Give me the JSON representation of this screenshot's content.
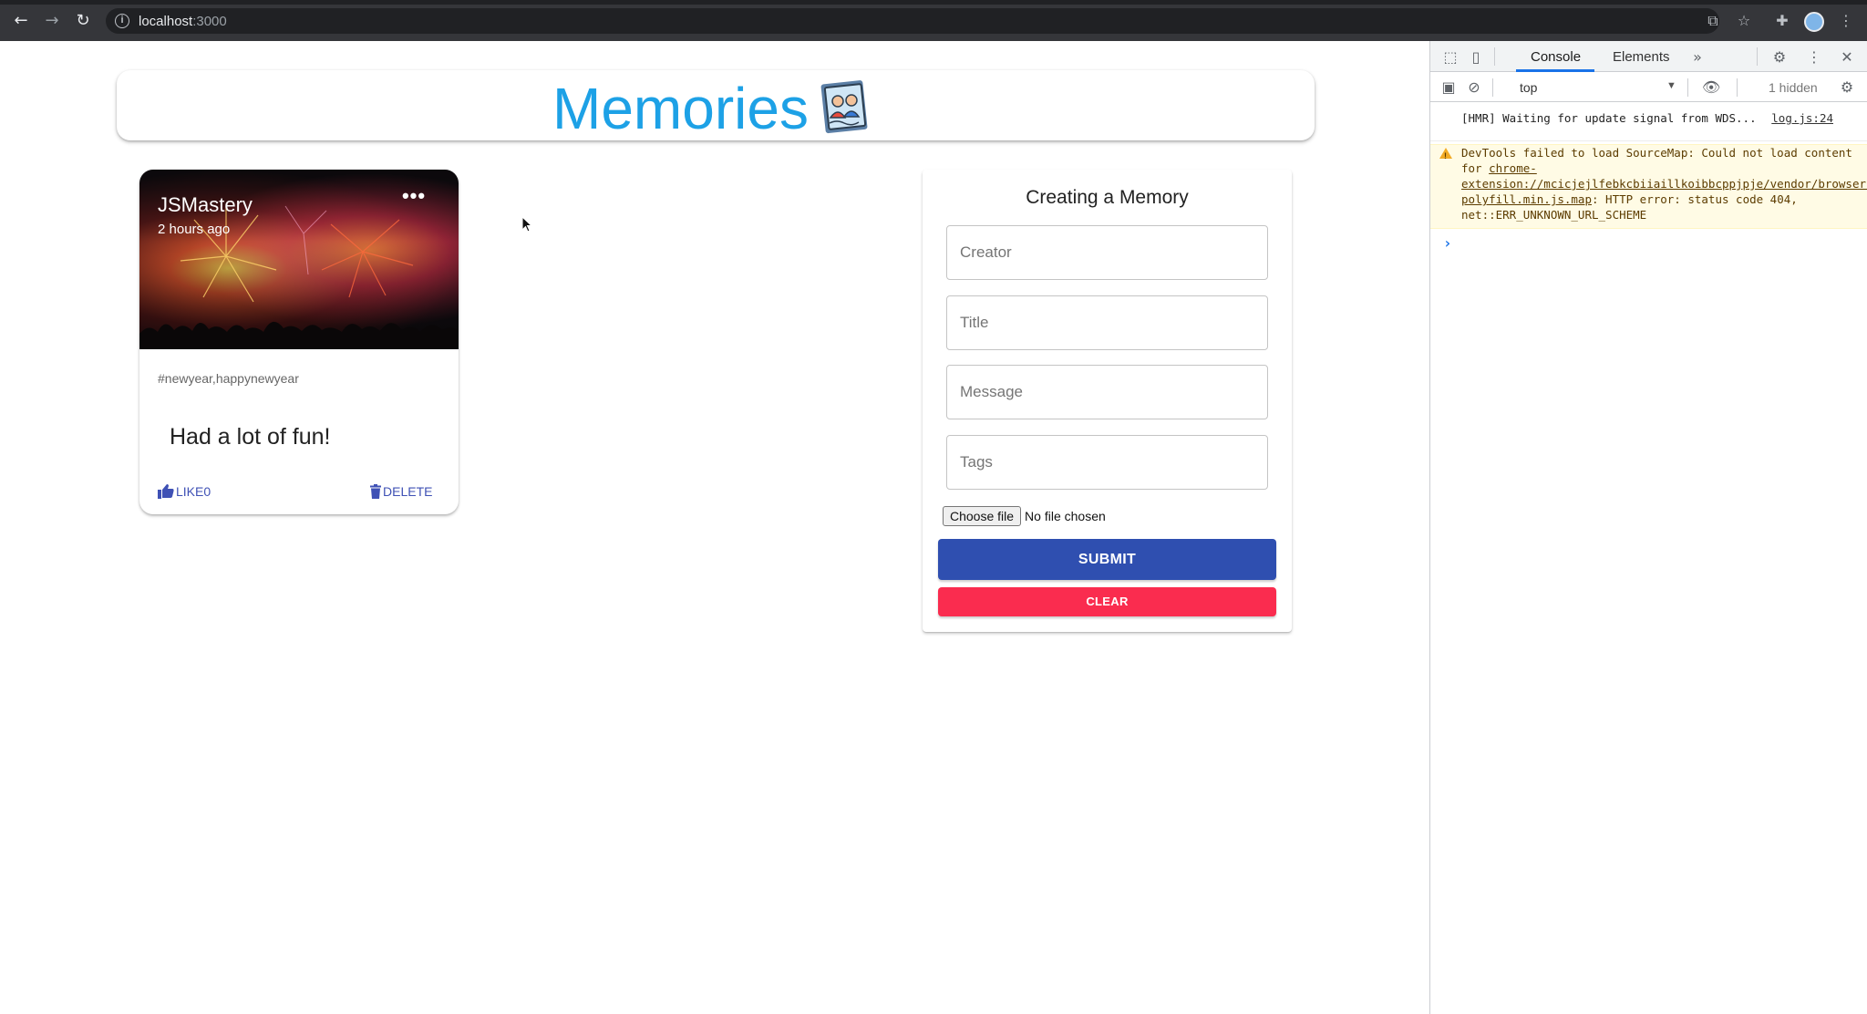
{
  "browser": {
    "url_host": "localhost",
    "url_port": ":3000",
    "icons": [
      "back-arrow-icon",
      "forward-arrow-icon",
      "reload-icon",
      "info-icon",
      "open-in-new-icon",
      "star-icon",
      "extensions-icon",
      "profile-avatar",
      "kebab-menu-icon"
    ]
  },
  "app": {
    "heading": "Memories",
    "logo_icon": "memories-photo-icon"
  },
  "post": {
    "creator": "JSMastery",
    "time_ago": "2 hours ago",
    "more_label": "•••",
    "tags": "#newyear,happynewyear",
    "message": "Had a lot of fun!",
    "like_label": "LIKE",
    "like_count": "0",
    "delete_label": "DELETE"
  },
  "form": {
    "title": "Creating a Memory",
    "fields": {
      "creator_placeholder": "Creator",
      "title_placeholder": "Title",
      "message_placeholder": "Message",
      "tags_placeholder": "Tags"
    },
    "file_button": "Choose file",
    "file_status": "No file chosen",
    "submit_label": "SUBMIT",
    "clear_label": "CLEAR"
  },
  "devtools": {
    "tabs": [
      "Console",
      "Elements"
    ],
    "more_tabs": "»",
    "context": "top",
    "hidden_count": "1 hidden",
    "logs": {
      "hmr_text": "[HMR] Waiting for update signal from WDS...",
      "hmr_source": "log.js:24",
      "warn_prefix": "DevTools failed to load SourceMap: Could not load content for ",
      "warn_link": "chrome-extension://mcicjejlfebkcbiiaillkoibbcppjpje/vendor/browser-polyfill.min.js.map",
      "warn_suffix": ": HTTP error: status code 404, net::ERR_UNKNOWN_URL_SCHEME"
    },
    "prompt": "›"
  },
  "colors": {
    "brand_blue": "#1da1e6",
    "submit_blue": "#2f4fb0",
    "clear_pink": "#fa2c4f",
    "link_indigo": "#3f51b5"
  }
}
